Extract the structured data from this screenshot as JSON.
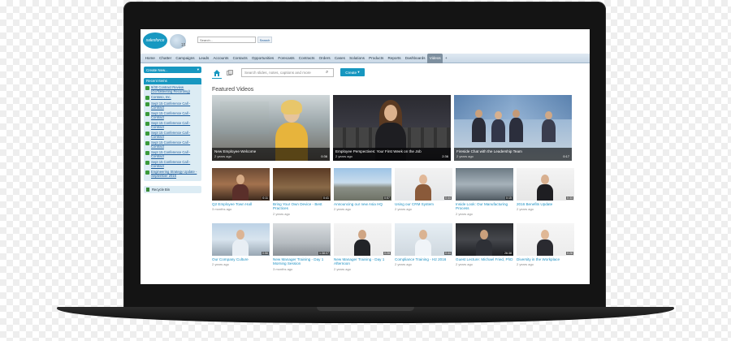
{
  "header": {
    "logo_text": "salesforce",
    "badge_text": "15",
    "search_placeholder": "Search...",
    "search_button": "Search"
  },
  "nav": {
    "tabs": [
      "Home",
      "Chatter",
      "Campaigns",
      "Leads",
      "Accounts",
      "Contacts",
      "Opportunities",
      "Forecasts",
      "Contracts",
      "Orders",
      "Cases",
      "Solutions",
      "Products",
      "Reports",
      "Dashboards",
      "Videos",
      "+"
    ],
    "active": "Videos"
  },
  "sidebar": {
    "create_new_label": "Create New...",
    "create_new_arrow": "▾",
    "recent_title": "Recent Items",
    "recent_items": [
      "9/30 Contract Review (GoToMeeting Recording)",
      "Contoso, Inc.",
      "Sept 15 Conference Call - Contract",
      "Sept 15 Conference Call - Contract",
      "Sept 15 Conference Call - Contract",
      "Sept 15 Conference Call - Contract",
      "Sept 15 Conference Call - Contract",
      "Sept 15 Conference Call - Contract",
      "Sept 15 Conference Call - Contract",
      "Engineering Strategy Update - September 2016"
    ],
    "recycle_bin_label": "Recycle Bin"
  },
  "toolbar": {
    "search_placeholder": "Search slides, notes, captions and more",
    "create_label": "Create",
    "create_arrow": "▾"
  },
  "featured": {
    "title": "Featured Videos",
    "videos": [
      {
        "title": "New Employee Welcome",
        "meta": "2 years ago",
        "duration": "0:36"
      },
      {
        "title": "Employee Perspectives: Your First Week on the Job",
        "meta": "2 years ago",
        "duration": "2:36"
      },
      {
        "title": "Fireside Chat with the Leadership Team",
        "meta": "2 years ago",
        "duration": "0:17"
      }
    ]
  },
  "videos_row1": [
    {
      "title": "Q2 Employee Town Hall",
      "meta": "3 months ago",
      "duration": "0:11"
    },
    {
      "title": "Bring Your Own Device - Best Practices",
      "meta": "2 years ago",
      "duration": "0:41"
    },
    {
      "title": "Announcing our new Asia HQ",
      "meta": "2 years ago",
      "duration": "0:57"
    },
    {
      "title": "Using our CRM System",
      "meta": "2 years ago",
      "duration": "0:44"
    },
    {
      "title": "Inside Look: Our Manufacturing Process",
      "meta": "2 years ago",
      "duration": "0:15"
    },
    {
      "title": "2016 Benefits Update",
      "meta": "2 years ago",
      "duration": "0:33"
    }
  ],
  "videos_row2": [
    {
      "title": "Our Company Culture",
      "meta": "2 years ago",
      "duration": "0:56"
    },
    {
      "title": "New Manager Training - Day 1 Morning Session",
      "meta": "3 months ago",
      "duration": "1:38:07"
    },
    {
      "title": "New Manager Training - Day 1 Afternoon",
      "meta": "2 years ago",
      "duration": "0:28"
    },
    {
      "title": "Compliance Training - H2 2016",
      "meta": "2 years ago",
      "duration": "0:44"
    },
    {
      "title": "Guest Lecture: Michael Fried, PhD",
      "meta": "2 years ago",
      "duration": "26:38"
    },
    {
      "title": "Diversity in the Workplace",
      "meta": "2 years ago",
      "duration": "0:28"
    }
  ],
  "colors": {
    "brand": "#1797c0",
    "link": "#1a8fc2"
  }
}
